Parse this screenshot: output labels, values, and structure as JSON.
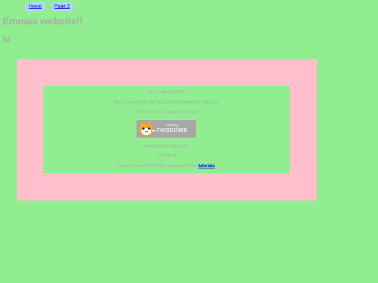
{
  "nav": {
    "home_label": "Home",
    "page2_label": "Page 2"
  },
  "header": {
    "title": "Emmas website!!",
    "subtitle": "hi"
  },
  "content": {
    "together": "Let us see together:",
    "bold_pre": "Here's a way that how you can make ",
    "bold_word": "bold",
    "bold_post": " and italic text.",
    "image_line": "Here's how you can add an image:",
    "badge_small": "hosted by",
    "badge_big": "neocities",
    "list_line": "Here's how to make a list:",
    "list_items": [
      "First thing"
    ],
    "learn_pre": "To learn more HTML/CSS, check out these ",
    "learn_link": "tutorials",
    "learn_post": "!"
  },
  "colors": {
    "background": "#90ee90",
    "outer_box": "#ffc0cb",
    "nav_button": "#add8e6",
    "text": "#a9a9a9",
    "link": "#0000ee"
  }
}
